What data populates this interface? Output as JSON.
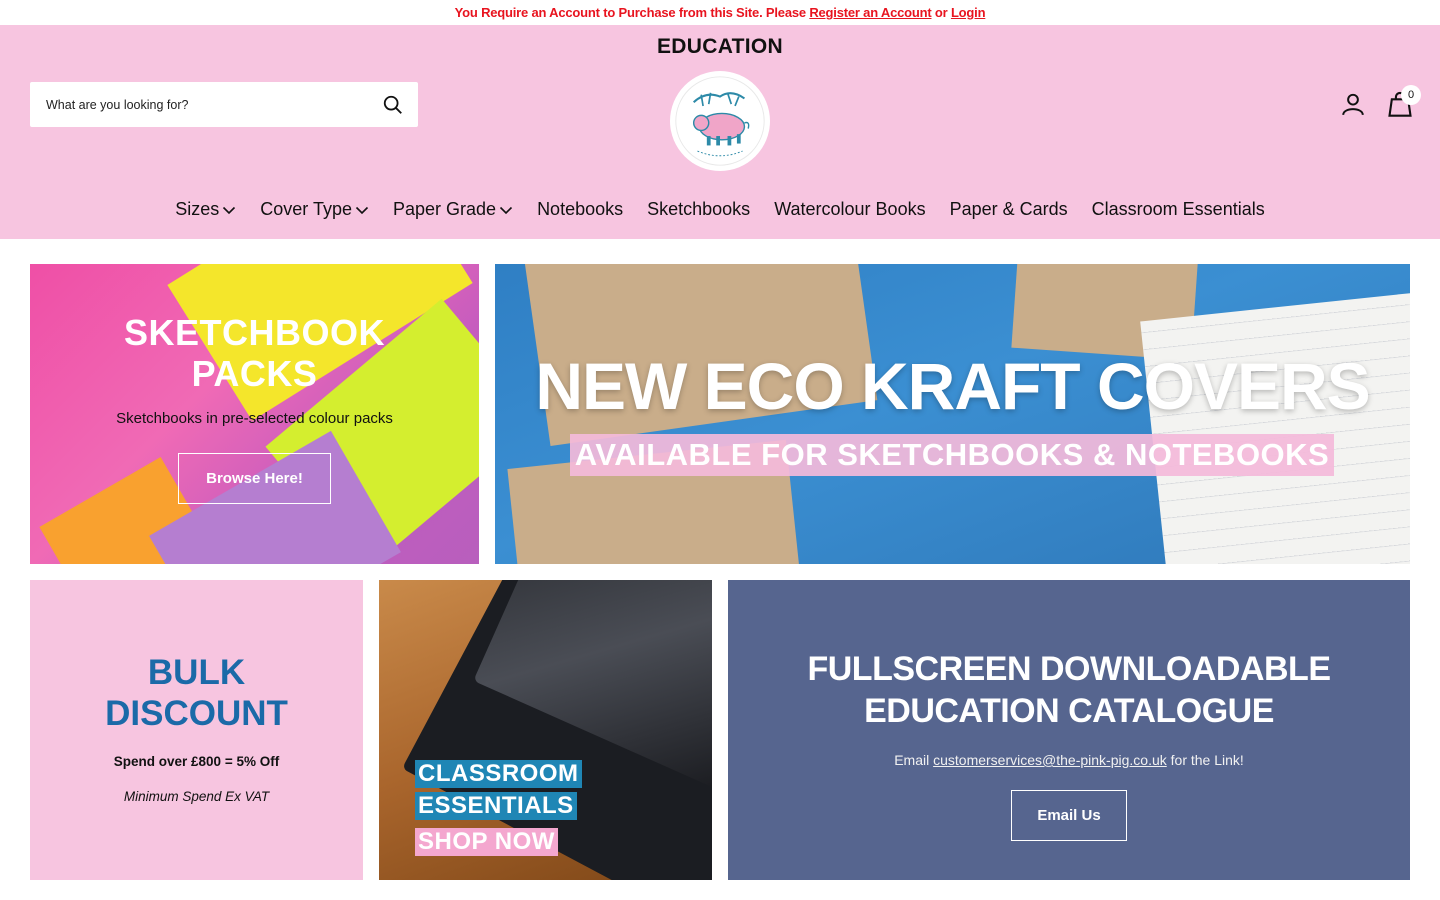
{
  "announcement": {
    "prefix": "You Require an Account to Purchase from this Site. Please",
    "register_link": "Register an Account",
    "or_text": "or",
    "login_link": "Login"
  },
  "header": {
    "title": "EDUCATION",
    "search_placeholder": "What are you looking for?",
    "cart_count": "0",
    "background_color": "#f7c5e0"
  },
  "nav": {
    "items": [
      {
        "label": "Sizes",
        "has_dropdown": true
      },
      {
        "label": "Cover Type",
        "has_dropdown": true
      },
      {
        "label": "Paper Grade",
        "has_dropdown": true
      },
      {
        "label": "Notebooks",
        "has_dropdown": false
      },
      {
        "label": "Sketchbooks",
        "has_dropdown": false
      },
      {
        "label": "Watercolour Books",
        "has_dropdown": false
      },
      {
        "label": "Paper & Cards",
        "has_dropdown": false
      },
      {
        "label": "Classroom Essentials",
        "has_dropdown": false
      }
    ]
  },
  "tiles": {
    "sketchbook": {
      "title_line1": "SKETCHBOOK",
      "title_line2": "PACKS",
      "subtitle": "Sketchbooks in pre-selected colour packs",
      "button": "Browse Here!"
    },
    "eco": {
      "title": "NEW ECO KRAFT COVERS",
      "subtitle": "AVAILABLE FOR SKETCHBOOKS & NOTEBOOKS"
    },
    "bulk": {
      "title_line1": "BULK",
      "title_line2": "DISCOUNT",
      "line1": "Spend over £800 = 5% Off",
      "line2": "Minimum Spend Ex VAT",
      "title_color": "#1b6aa8"
    },
    "classroom": {
      "label1": "CLASSROOM",
      "label2": "ESSENTIALS",
      "label3": "SHOP NOW"
    },
    "catalogue": {
      "title_line1": "FULLSCREEN DOWNLOADABLE",
      "title_line2": "EDUCATION CATALOGUE",
      "text_prefix": "Email",
      "email": "customerservices@the-pink-pig.co.uk",
      "text_suffix": "for the Link!",
      "button": "Email Us"
    }
  },
  "colors": {
    "announcement_text": "#e8141f",
    "accent_pink": "#f7c5e0",
    "catalogue_bg": "#56658f"
  },
  "icons": [
    "search-icon",
    "account-icon",
    "cart-icon",
    "chevron-down-icon",
    "pink-pig-logo"
  ]
}
